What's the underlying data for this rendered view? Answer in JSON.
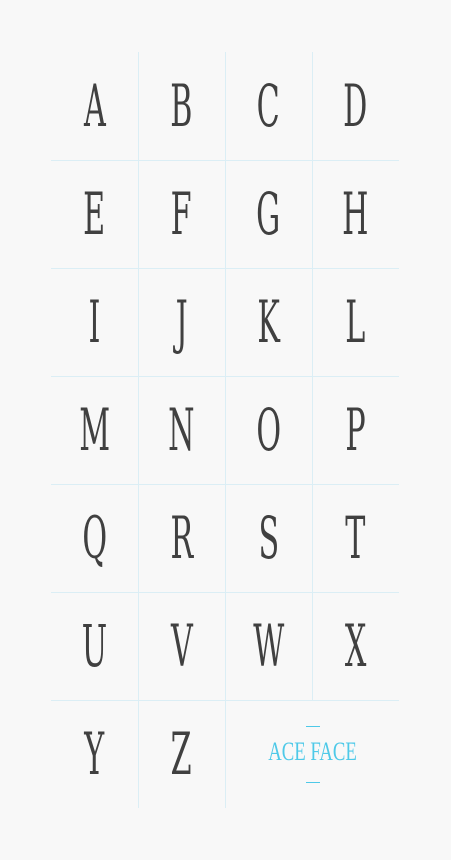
{
  "letters": [
    "A",
    "B",
    "C",
    "D",
    "E",
    "F",
    "G",
    "H",
    "I",
    "J",
    "K",
    "L",
    "M",
    "N",
    "O",
    "P",
    "Q",
    "R",
    "S",
    "T",
    "U",
    "V",
    "W",
    "X",
    "Y",
    "Z"
  ],
  "brand": {
    "name": "ACE FACE"
  },
  "colors": {
    "glyph": "#404040",
    "accent": "#4ec9e8",
    "grid": "#dbeef5",
    "background": "#f8f8f8"
  }
}
